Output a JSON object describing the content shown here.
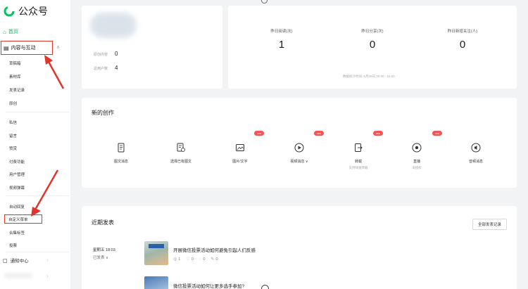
{
  "brand": {
    "name": "公众号"
  },
  "sidebar": {
    "home": "首页",
    "content_interaction": "内容与互动",
    "content_sub": [
      "草稿箱",
      "素材库",
      "发表记录",
      "原创"
    ],
    "interaction_sub": [
      "私信",
      "留言",
      "赞赏",
      "付费功能",
      "用户管理",
      "视频弹幕"
    ],
    "menu_sub": [
      "自动回复",
      "自定义菜单",
      "合集标签",
      "投票"
    ],
    "notify": "通知中心"
  },
  "profile": {
    "rows": [
      {
        "label": "原创内容",
        "value": "0"
      },
      {
        "label": "总用户数",
        "value": "4"
      }
    ]
  },
  "stats": {
    "items": [
      {
        "label": "昨日阅读(次)",
        "value": "1"
      },
      {
        "label": "昨日分享(次)",
        "value": "0"
      },
      {
        "label": "昨日新增关注(人)",
        "value": "0"
      }
    ],
    "note": "数据统计时间: 5月26日 00:00 - 24:00"
  },
  "create": {
    "title": "新的创作",
    "tools": [
      {
        "label": "图文消息",
        "sub": "",
        "icon": "doc-icon",
        "new": false
      },
      {
        "label": "选择已有图文",
        "sub": "",
        "icon": "doc-select-icon",
        "new": false
      },
      {
        "label": "图片/文字",
        "sub": "",
        "icon": "image-icon",
        "new": true
      },
      {
        "label": "视频消息 ∨",
        "sub": "",
        "icon": "play-icon",
        "new": true
      },
      {
        "label": "转载",
        "sub": "支持快速转载",
        "icon": "repost-icon",
        "new": true
      },
      {
        "label": "直播",
        "sub": "未授权",
        "icon": "live-icon",
        "new": true
      },
      {
        "label": "音频消息",
        "sub": "",
        "icon": "audio-icon",
        "new": false
      }
    ],
    "badge": "new"
  },
  "recent": {
    "title": "近期发表",
    "all_button": "全部发表记录",
    "post": {
      "date": "星期五 18:03",
      "status": "已发表 ∨",
      "title": "开展微信投票活动如何避免引起人们反感",
      "metrics": [
        "1",
        "0",
        "0",
        "0"
      ]
    },
    "post2": {
      "title": "微信投票活动如何让更多选手参加?"
    }
  },
  "colors": {
    "accent": "#07c160",
    "annotation": "#e0352b",
    "badge": "#fa5151"
  }
}
